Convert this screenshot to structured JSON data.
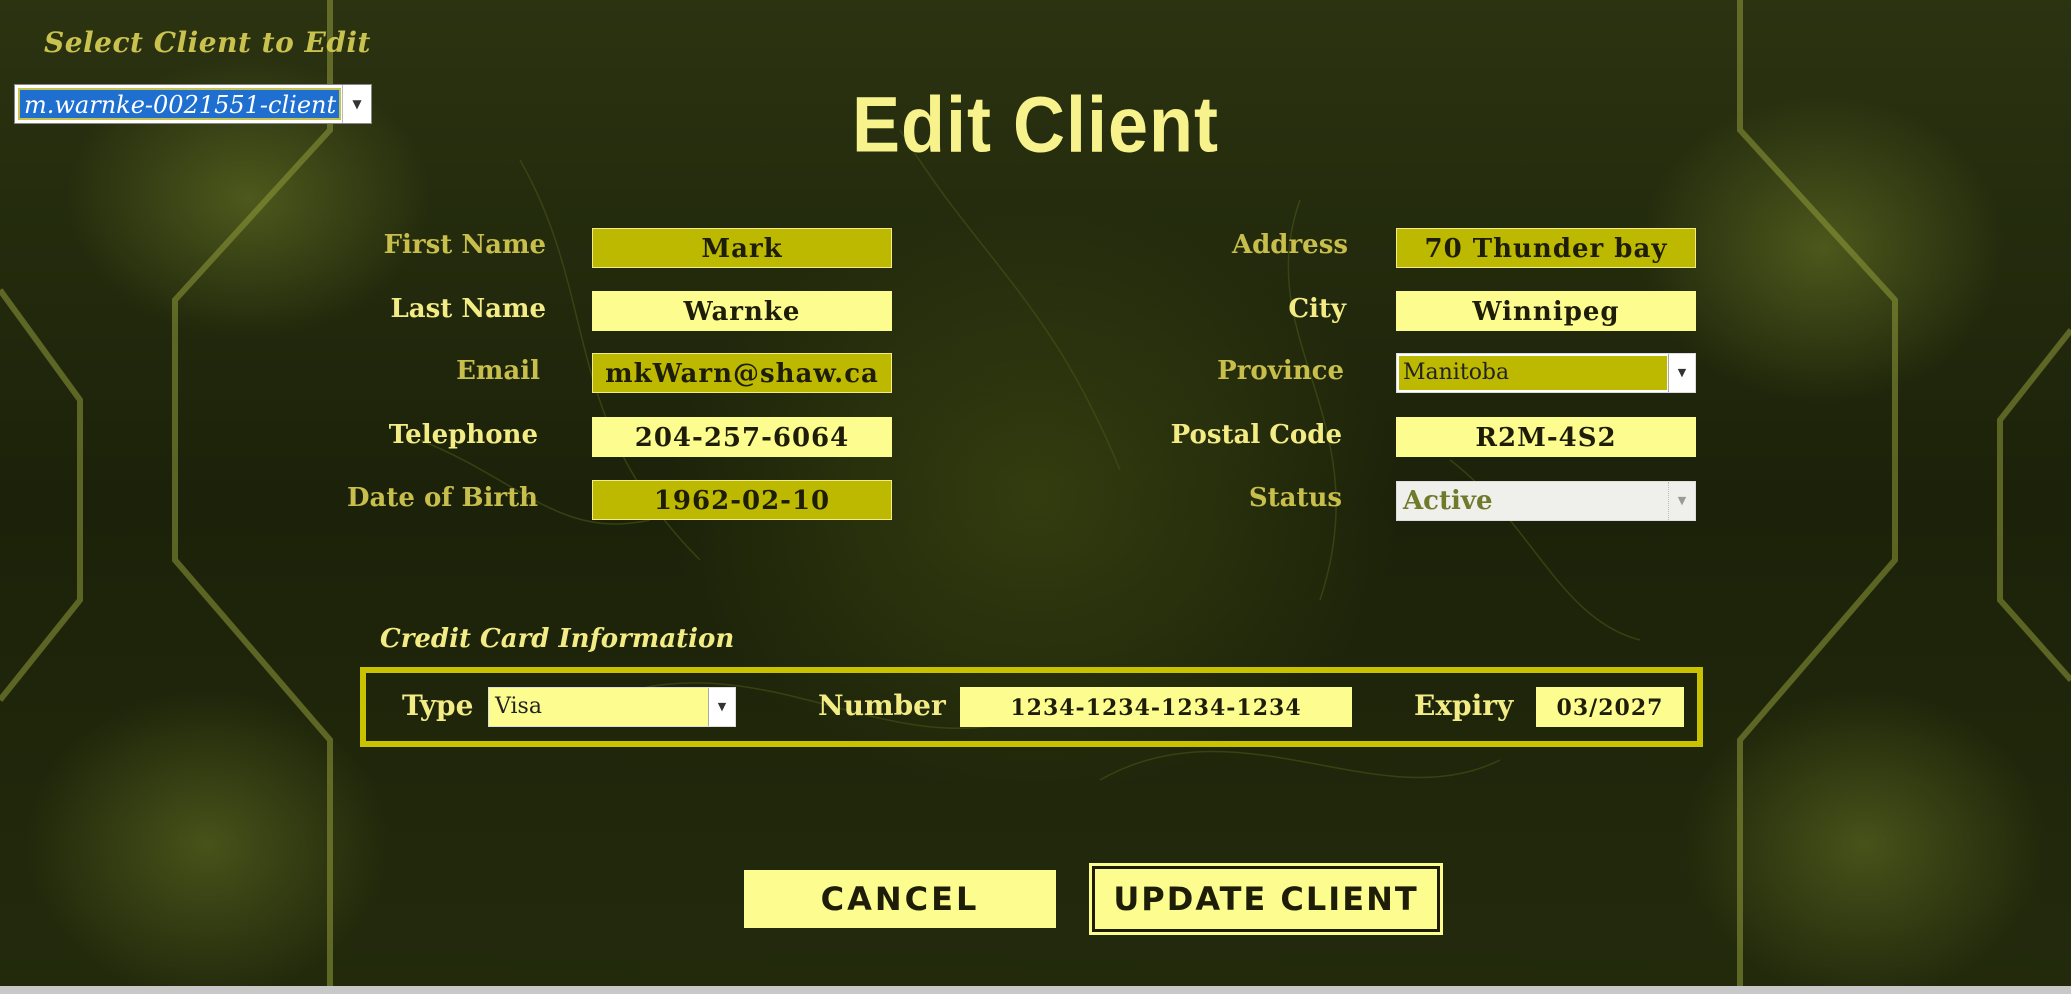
{
  "select_client": {
    "label": "Select Client to Edit",
    "selected": "m.warnke-0021551-client"
  },
  "title": "Edit Client",
  "client": {
    "first_name": {
      "label": "First Name",
      "value": "Mark"
    },
    "last_name": {
      "label": "Last Name",
      "value": "Warnke"
    },
    "email": {
      "label": "Email",
      "value": "mkWarn@shaw.ca"
    },
    "telephone": {
      "label": "Telephone",
      "value": "204-257-6064"
    },
    "dob": {
      "label": "Date of Birth",
      "value": "1962-02-10"
    },
    "address": {
      "label": "Address",
      "value": "70 Thunder bay"
    },
    "city": {
      "label": "City",
      "value": "Winnipeg"
    },
    "province": {
      "label": "Province",
      "value": "Manitoba"
    },
    "postal_code": {
      "label": "Postal Code",
      "value": "R2M-4S2"
    },
    "status": {
      "label": "Status",
      "value": "Active"
    }
  },
  "credit_card": {
    "section_label": "Credit Card Information",
    "type": {
      "label": "Type",
      "value": "Visa"
    },
    "number": {
      "label": "Number",
      "value": "1234-1234-1234-1234"
    },
    "expiry": {
      "label": "Expiry",
      "value": "03/2027"
    }
  },
  "buttons": {
    "cancel": "CANCEL",
    "update": "UPDATE CLIENT"
  },
  "colors": {
    "accent_light": "#fdfc8e",
    "accent_dark": "#bdb800",
    "label": "#f3ec84",
    "selection": "#1f6fd1"
  }
}
